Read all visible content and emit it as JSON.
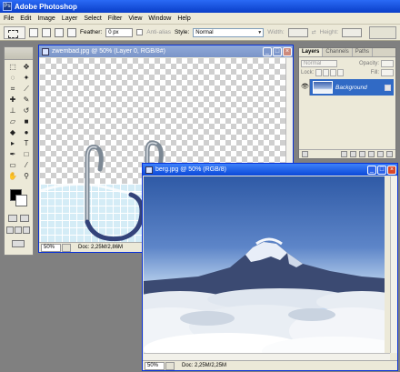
{
  "app": {
    "title": "Adobe Photoshop",
    "logo_icon": "photoshop-icon"
  },
  "menu": [
    "File",
    "Edit",
    "Image",
    "Layer",
    "Select",
    "Filter",
    "View",
    "Window",
    "Help"
  ],
  "options_bar": {
    "feather_label": "Feather:",
    "feather_value": "0 px",
    "anti_alias_label": "Anti-alias",
    "style_label": "Style:",
    "style_value": "Normal",
    "width_label": "Width:",
    "height_label": "Height:"
  },
  "toolbox": {
    "tools": [
      {
        "icon": "marquee-icon",
        "glyph": "⬚"
      },
      {
        "icon": "move-icon",
        "glyph": "✥"
      },
      {
        "icon": "lasso-icon",
        "glyph": "◌"
      },
      {
        "icon": "magic-wand-icon",
        "glyph": "✦"
      },
      {
        "icon": "crop-icon",
        "glyph": "⌗"
      },
      {
        "icon": "slice-icon",
        "glyph": "⟋"
      },
      {
        "icon": "healing-brush-icon",
        "glyph": "✚"
      },
      {
        "icon": "brush-icon",
        "glyph": "✎"
      },
      {
        "icon": "clone-stamp-icon",
        "glyph": "⊥"
      },
      {
        "icon": "history-brush-icon",
        "glyph": "↺"
      },
      {
        "icon": "eraser-icon",
        "glyph": "▱"
      },
      {
        "icon": "gradient-icon",
        "glyph": "■"
      },
      {
        "icon": "blur-icon",
        "glyph": "◆"
      },
      {
        "icon": "dodge-icon",
        "glyph": "●"
      },
      {
        "icon": "path-selection-icon",
        "glyph": "▸"
      },
      {
        "icon": "type-icon",
        "glyph": "T"
      },
      {
        "icon": "pen-icon",
        "glyph": "✒"
      },
      {
        "icon": "shape-icon",
        "glyph": "□"
      },
      {
        "icon": "notes-icon",
        "glyph": "▭"
      },
      {
        "icon": "eyedropper-icon",
        "glyph": "⁄"
      },
      {
        "icon": "hand-icon",
        "glyph": "✋"
      },
      {
        "icon": "zoom-icon",
        "glyph": "⚲"
      }
    ],
    "foreground_color": "#000000",
    "background_color": "#ffffff"
  },
  "documents": {
    "zwembad": {
      "title": "zwembad.jpg @ 50% (Layer 0, RGB/8#)",
      "zoom": "50%",
      "doc_size": "Doc: 2,25M/2,86M"
    },
    "berg": {
      "title": "berg.jpg @ 50% (RGB/8)",
      "zoom": "50%",
      "doc_size": "Doc: 2,25M/2,25M"
    }
  },
  "window_buttons": {
    "minimize": "_",
    "maximize": "□",
    "close": "×"
  },
  "layers_panel": {
    "tabs": [
      "Layers",
      "Channels",
      "Paths"
    ],
    "active_tab": "Layers",
    "blend_mode": "Normal",
    "opacity_label": "Opacity:",
    "lock_label": "Lock:",
    "fill_label": "Fill:",
    "layers": [
      {
        "name": "Background",
        "visible": true,
        "locked": true
      }
    ]
  },
  "colors": {
    "titlebar": "#0a3ec8",
    "selection": "#316ac5",
    "close_button": "#d8482a",
    "workspace": "#808080"
  }
}
